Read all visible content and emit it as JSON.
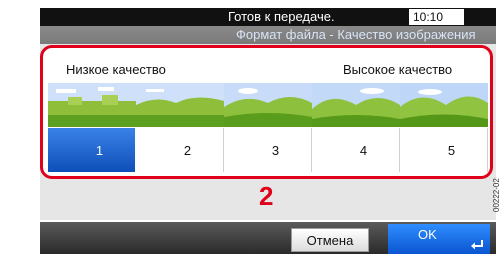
{
  "status": {
    "message": "Готов к передаче.",
    "time": "10:10"
  },
  "title": "Формат файла - Качество изображения",
  "quality": {
    "low_label": "Низкое качество",
    "high_label": "Высокое качество",
    "levels": [
      "1",
      "2",
      "3",
      "4",
      "5"
    ],
    "selected": "1"
  },
  "callout": "2",
  "buttons": {
    "cancel": "Отмена",
    "ok": "OK"
  },
  "side_code": "00222-02",
  "colors": {
    "highlight": "#e0001b",
    "selected": "#1a5fd0",
    "ok": "#0a55d0"
  },
  "icons": {
    "enter": "enter-icon"
  }
}
